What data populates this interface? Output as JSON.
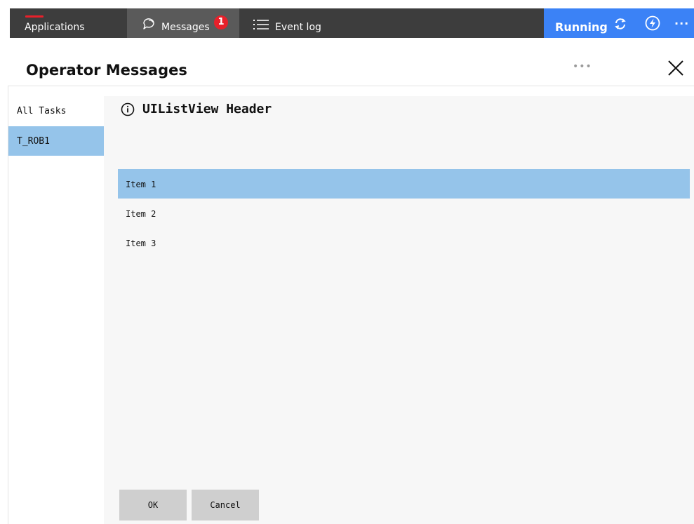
{
  "topbar": {
    "applications_label": "Applications",
    "messages_label": "Messages",
    "messages_badge": "1",
    "event_log_label": "Event log",
    "status_label": "Running",
    "more_label": "···",
    "icons": [
      "messages-icon",
      "list-icon",
      "sync-icon",
      "bolt-icon"
    ]
  },
  "dialog": {
    "title": "Operator Messages",
    "menu_label": "•••",
    "close_icon": "close-icon"
  },
  "sidebar": {
    "items": [
      {
        "label": "All Tasks",
        "selected": false
      },
      {
        "label": "T_ROB1",
        "selected": true
      }
    ]
  },
  "main": {
    "header": "UIListView Header",
    "items": [
      {
        "label": "Item 1",
        "selected": true
      },
      {
        "label": "Item 2",
        "selected": false
      },
      {
        "label": "Item 3",
        "selected": false
      }
    ],
    "ok_label": "OK",
    "cancel_label": "Cancel"
  },
  "colors": {
    "topbar": "#3d3d3d",
    "active_tab": "#5a5a5a",
    "status": "#3b82f6",
    "selection": "#95c4ea",
    "badge": "#e8202a"
  }
}
